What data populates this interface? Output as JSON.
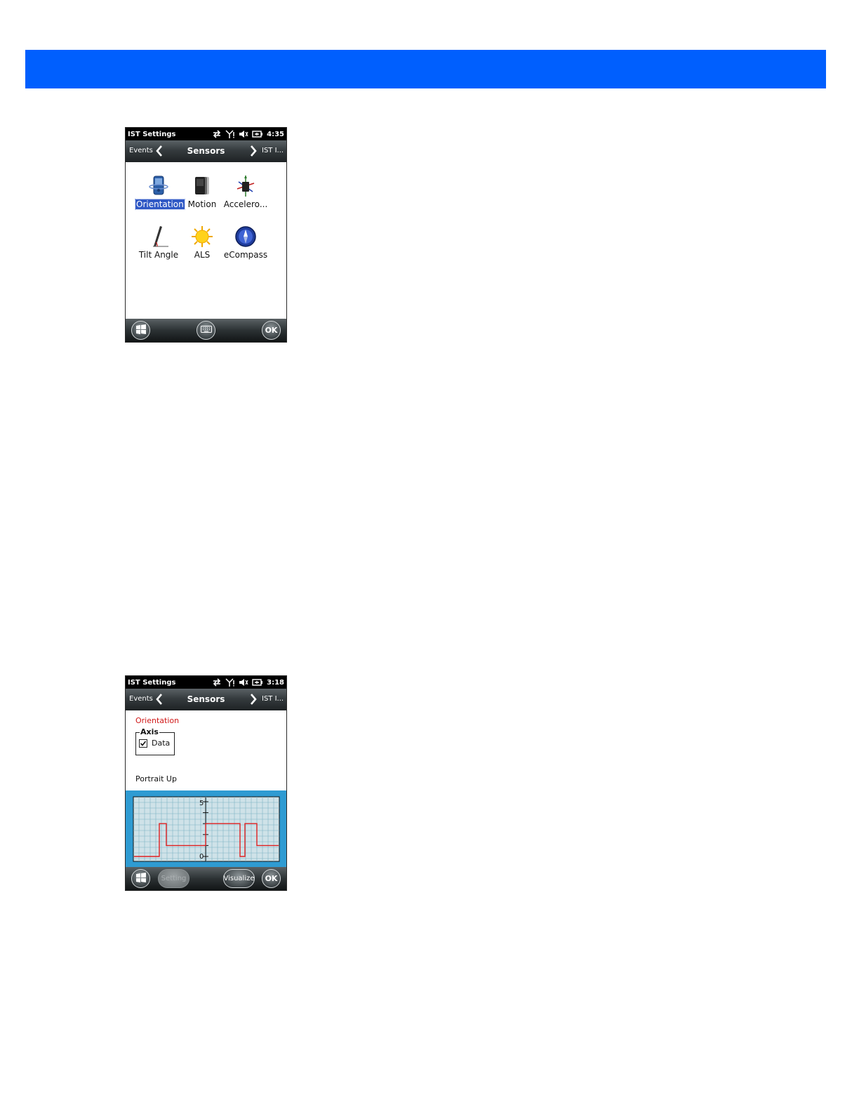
{
  "colors": {
    "banner": "#005ffe",
    "selection": "#2f58c5",
    "orientation_title": "#d01818",
    "graph_panel": "#2f9bd2",
    "graph_background": "#cfe2e8",
    "graph_line": "#e02020"
  },
  "screen1": {
    "status": {
      "title": "IST Settings",
      "time": "4:35",
      "icons": [
        "sync-arrows-icon",
        "signal-icon",
        "speaker-muted-icon",
        "battery-charging-icon"
      ]
    },
    "nav": {
      "left": "Events",
      "title": "Sensors",
      "right": "IST I..."
    },
    "sensors": [
      {
        "label": "Orientation",
        "icon": "orientation-phone-icon",
        "selected": true
      },
      {
        "label": "Motion",
        "icon": "motion-phone-icon"
      },
      {
        "label": "Accelero...",
        "icon": "accelerometer-icon"
      },
      {
        "label": "Tilt Angle",
        "icon": "tilt-angle-icon"
      },
      {
        "label": "ALS",
        "icon": "sun-icon"
      },
      {
        "label": "eCompass",
        "icon": "compass-icon"
      }
    ],
    "softbar": {
      "left_icon": "windows-start-icon",
      "center_icon": "keyboard-icon",
      "ok": "OK"
    }
  },
  "screen2": {
    "status": {
      "title": "IST Settings",
      "time": "3:18"
    },
    "nav": {
      "left": "Events",
      "title": "Sensors",
      "right": "IST I..."
    },
    "orientation_title": "Orientation",
    "axis_group": {
      "legend": "Axis",
      "checkbox_label": "Data",
      "checked": true
    },
    "orientation_state": "Portrait Up",
    "graph": {
      "type": "line",
      "y_tick_labels": [
        "5",
        "0"
      ],
      "ylim": [
        0,
        5
      ],
      "segments_value": [
        0,
        3,
        1,
        3,
        0,
        3,
        1
      ]
    },
    "softbar": {
      "left_icon": "windows-start-icon",
      "setting": "Setting",
      "visualize": "Visualize",
      "ok": "OK"
    }
  }
}
